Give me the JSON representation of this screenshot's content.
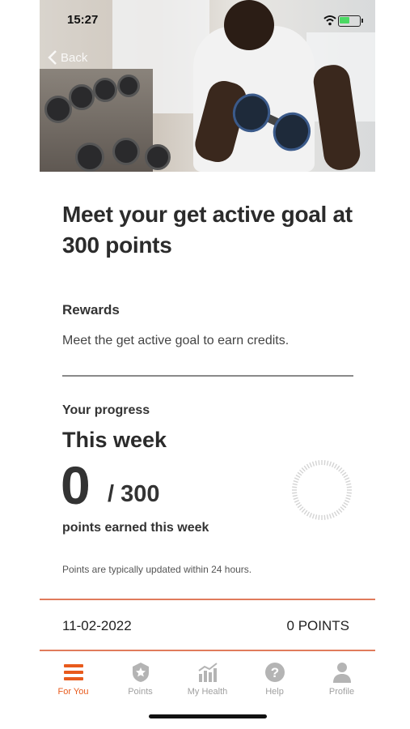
{
  "status_bar": {
    "time": "15:27"
  },
  "header": {
    "back_label": "Back"
  },
  "goal": {
    "title": "Meet your get active goal at 300 points"
  },
  "rewards": {
    "heading": "Rewards",
    "text": "Meet the get active goal to earn credits."
  },
  "progress": {
    "heading": "Your progress",
    "period": "This week",
    "points_earned": "0",
    "points_goal": "/ 300",
    "earned_label": "points earned this week",
    "fraction_complete": 0,
    "update_note": "Points are typically updated within 24 hours."
  },
  "history": [
    {
      "date": "11-02-2022",
      "points": "0 POINTS"
    }
  ],
  "tabs": [
    {
      "label": "For You",
      "icon": "list-icon",
      "active": true
    },
    {
      "label": "Points",
      "icon": "star-badge-icon",
      "active": false
    },
    {
      "label": "My Health",
      "icon": "bar-chart-icon",
      "active": false
    },
    {
      "label": "Help",
      "icon": "help-icon",
      "active": false
    },
    {
      "label": "Profile",
      "icon": "person-icon",
      "active": false
    }
  ],
  "colors": {
    "accent": "#e85a1c",
    "divider_orange": "#e07b5c",
    "inactive": "#a0a0a0"
  }
}
